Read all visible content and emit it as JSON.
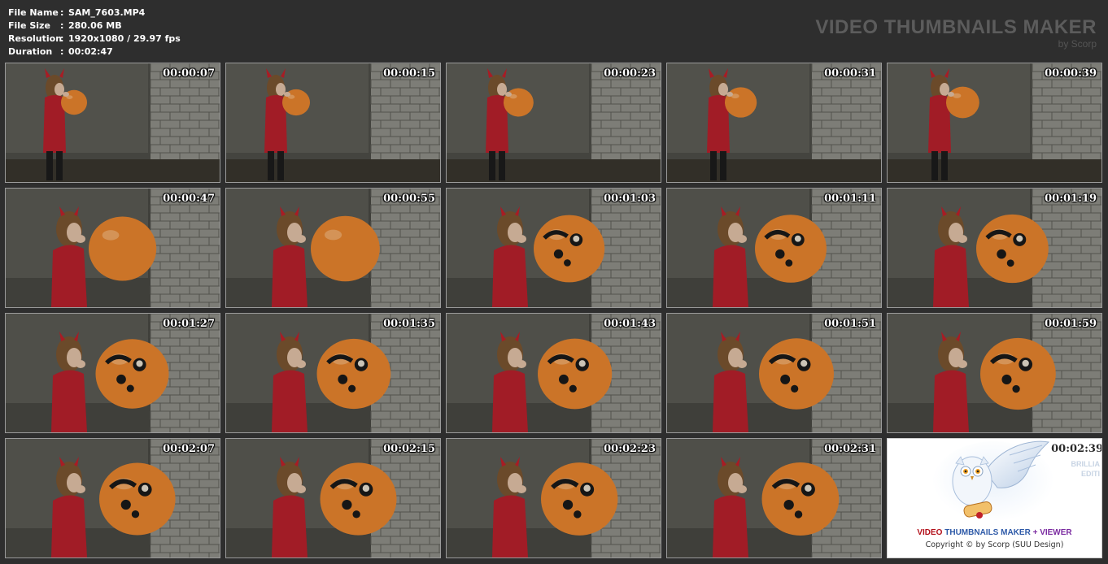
{
  "file_info": [
    {
      "label": "File Name",
      "sep": ":",
      "value": "SAM_7603.MP4"
    },
    {
      "label": "File Size",
      "sep": ":",
      "value": "280.06 MB"
    },
    {
      "label": "Resolution",
      "sep": ":",
      "value": "1920x1080 / 29.97 fps"
    },
    {
      "label": "Duration",
      "sep": ":",
      "value": "00:02:47"
    }
  ],
  "brand": {
    "title": "VIDEO THUMBNAILS MAKER",
    "subtitle": "by Scorp"
  },
  "thumbnails": [
    {
      "time": "00:00:07",
      "balloon": 0.3
    },
    {
      "time": "00:00:15",
      "balloon": 0.35
    },
    {
      "time": "00:00:23",
      "balloon": 0.42
    },
    {
      "time": "00:00:31",
      "balloon": 0.48
    },
    {
      "time": "00:00:39",
      "balloon": 0.52
    },
    {
      "time": "00:00:47",
      "balloon": 0.68
    },
    {
      "time": "00:00:55",
      "balloon": 0.72
    },
    {
      "time": "00:01:03",
      "balloon": 0.78
    },
    {
      "time": "00:01:11",
      "balloon": 0.8
    },
    {
      "time": "00:01:19",
      "balloon": 0.82
    },
    {
      "time": "00:01:27",
      "balloon": 0.85
    },
    {
      "time": "00:01:35",
      "balloon": 0.87
    },
    {
      "time": "00:01:43",
      "balloon": 0.88
    },
    {
      "time": "00:01:51",
      "balloon": 0.9
    },
    {
      "time": "00:01:59",
      "balloon": 0.92
    },
    {
      "time": "00:02:07",
      "balloon": 0.94
    },
    {
      "time": "00:02:15",
      "balloon": 0.95
    },
    {
      "time": "00:02:23",
      "balloon": 0.96
    },
    {
      "time": "00:02:31",
      "balloon": 0.97
    }
  ],
  "logo_tile": {
    "time": "00:02:39",
    "side_lines": [
      "BRILLIA",
      "EDITI"
    ],
    "line1_a": "VIDEO ",
    "line1_b": "THUMBNAILS MAKER",
    "line1_c": " + VIEWER",
    "line2": "Copyright © by Scorp (SUU Design)"
  },
  "colors": {
    "background": "#2e2e2e",
    "sweater": "#b8202c",
    "balloon": "#e8852e"
  }
}
